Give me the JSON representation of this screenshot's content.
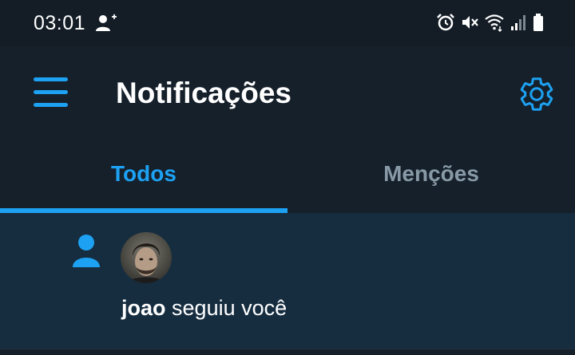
{
  "status_bar": {
    "time": "03:01",
    "left_icons": [
      "person-add-icon"
    ],
    "right_icons": [
      "alarm-icon",
      "vibrate-mute-icon",
      "wifi-icon",
      "signal-icon",
      "battery-icon"
    ]
  },
  "app_bar": {
    "title": "Notificações",
    "menu_icon": "hamburger-menu-icon",
    "settings_icon": "gear-icon"
  },
  "tabs": [
    {
      "label": "Todos",
      "active": true
    },
    {
      "label": "Menções",
      "active": false
    }
  ],
  "notifications": [
    {
      "type_icon": "person-icon",
      "user": "joao",
      "action": "seguiu você"
    }
  ],
  "colors": {
    "background": "#15202b",
    "status_bar": "#141d26",
    "accent": "#1da1f2",
    "inactive_tab": "#8899a6",
    "notification_bg": "#162d40"
  }
}
